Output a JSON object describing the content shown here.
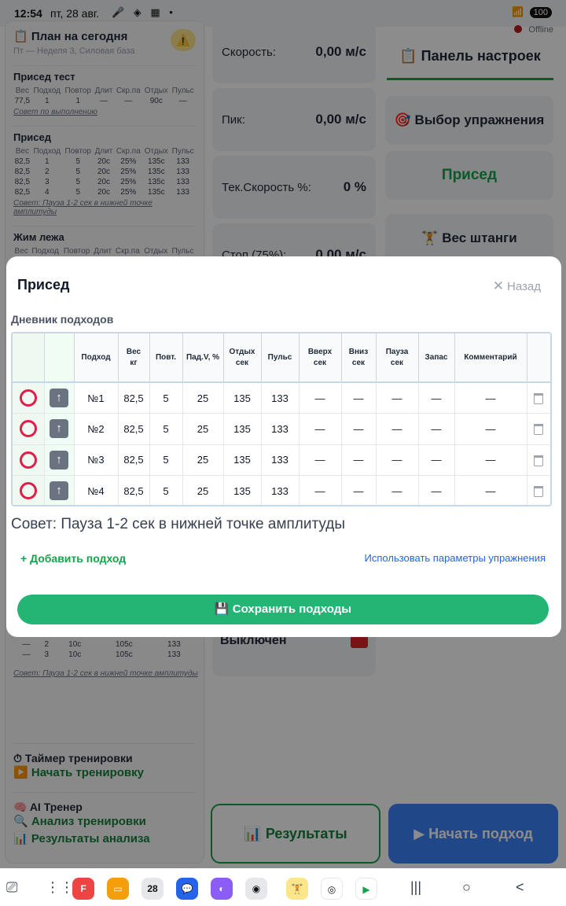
{
  "status_bar": {
    "time": "12:54",
    "date": "пт, 28 авг.",
    "battery": "100",
    "network_status": "Offline"
  },
  "left_panel": {
    "title": "План на сегодня",
    "subtitle": "Пт — Неделя 3, Силовая база",
    "warning_icon": "warning-icon",
    "columns": [
      "Вес",
      "Подход",
      "Повтор",
      "Длит",
      "Скр.па",
      "Отдых",
      "Пульс"
    ],
    "exercises": [
      {
        "name": "Присед тест",
        "rows": [
          [
            "77,5",
            "1",
            "1",
            "—",
            "—",
            "90с",
            "—"
          ]
        ],
        "tip": "Совет по выполнению"
      },
      {
        "name": "Присед",
        "rows": [
          [
            "82,5",
            "1",
            "5",
            "20с",
            "25%",
            "135с",
            "133"
          ],
          [
            "82,5",
            "2",
            "5",
            "20с",
            "25%",
            "135с",
            "133"
          ],
          [
            "82,5",
            "3",
            "5",
            "20с",
            "25%",
            "135с",
            "133"
          ],
          [
            "82,5",
            "4",
            "5",
            "20с",
            "25%",
            "135с",
            "133"
          ]
        ],
        "tip": "Совет: Пауза 1-2 сек в нижней точке амплитуды"
      },
      {
        "name": "Жим лежа",
        "rows": [],
        "tip": ""
      }
    ],
    "lower_rows": [
      [
        "—",
        "2",
        "10с",
        "105с",
        "133"
      ],
      [
        "—",
        "3",
        "10с",
        "105с",
        "133"
      ]
    ],
    "lower_tip": "Совет: Пауза 1-2 сек в нижней точке амплитуды",
    "timer_label": "Таймер тренировки",
    "start_training": "Начать тренировку",
    "ai_trainer": "AI Тренер",
    "analyze": "Анализ тренировки",
    "analysis_results": "Результаты анализа"
  },
  "metrics": [
    {
      "label": "Скорость:",
      "value": "0,00 м/с"
    },
    {
      "label": "Пик:",
      "value": "0,00 м/с"
    },
    {
      "label": "Тек.Скорость %:",
      "value": "0 %"
    },
    {
      "label": "Стоп (75%):",
      "value": "0,00 м/с"
    }
  ],
  "stop_panel": {
    "label": "Выключен"
  },
  "right_panel": {
    "settings_title": "📋 Панель настроек",
    "choose_exercise": "🎯 Выбор упражнения",
    "current_exercise": "Присед",
    "barbell_weight": "🏋 Вес штанги"
  },
  "bottom_buttons": {
    "results": "📊 Результаты",
    "start_set": "▶ Начать подход"
  },
  "modal": {
    "title": "Присед",
    "back": "Назад",
    "diary_title": "Дневник подходов",
    "headers": [
      "",
      "",
      "Подход",
      "Вес\nкг",
      "Повт.",
      "Пад.V, %",
      "Отдых\nсек",
      "Пульс",
      "Вверх\nсек",
      "Вниз\nсек",
      "Пауза\nсек",
      "Запас",
      "Комментарий",
      ""
    ],
    "rows": [
      {
        "set": "№1",
        "weight": "82,5",
        "reps": "5",
        "drop": "25",
        "rest": "135",
        "pulse": "133",
        "up": "—",
        "down": "—",
        "pause": "—",
        "reserve": "—",
        "comment": "—"
      },
      {
        "set": "№2",
        "weight": "82,5",
        "reps": "5",
        "drop": "25",
        "rest": "135",
        "pulse": "133",
        "up": "—",
        "down": "—",
        "pause": "—",
        "reserve": "—",
        "comment": "—"
      },
      {
        "set": "№3",
        "weight": "82,5",
        "reps": "5",
        "drop": "25",
        "rest": "135",
        "pulse": "133",
        "up": "—",
        "down": "—",
        "pause": "—",
        "reserve": "—",
        "comment": "—"
      },
      {
        "set": "№4",
        "weight": "82,5",
        "reps": "5",
        "drop": "25",
        "rest": "135",
        "pulse": "133",
        "up": "—",
        "down": "—",
        "pause": "—",
        "reserve": "—",
        "comment": "—"
      }
    ],
    "tip": "Совет: Пауза 1-2 сек в нижней точке амплитуды",
    "add_set": "+ Добавить подход",
    "use_params": "Использовать параметры упражнения",
    "save": "💾 Сохранить подходы"
  },
  "nav": {
    "calendar_day": "28"
  }
}
